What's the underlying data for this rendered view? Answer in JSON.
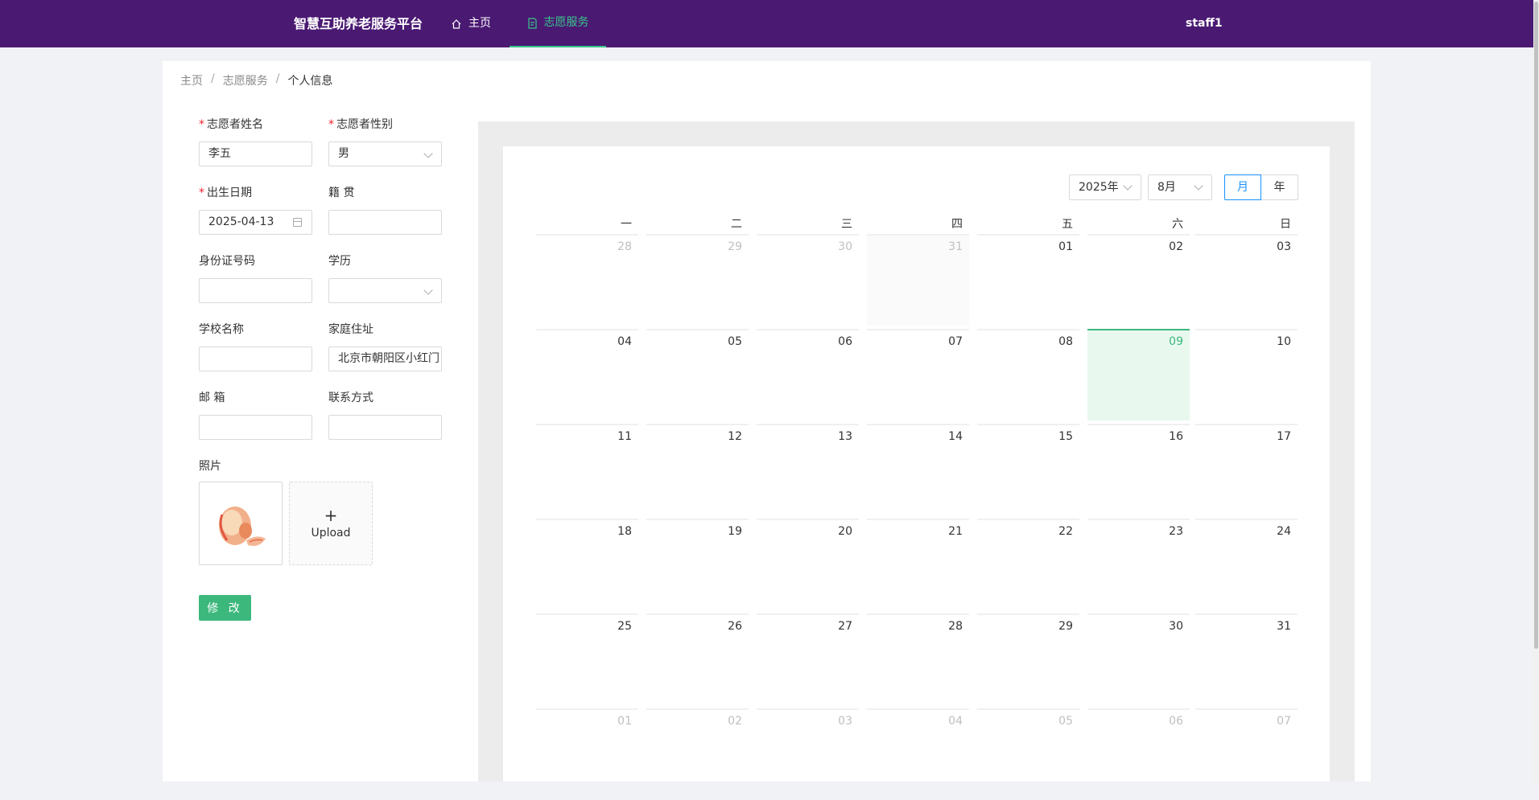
{
  "header": {
    "brand": "智慧互助养老服务平台",
    "nav": [
      {
        "label": "主页",
        "icon": "home-icon"
      },
      {
        "label": "志愿服务",
        "icon": "form-icon"
      }
    ],
    "user": "staff1",
    "colors": {
      "bar": "#4a1a73",
      "active": "#39c48a"
    }
  },
  "breadcrumb": [
    "主页",
    "/",
    "志愿服务",
    "/",
    "个人信息"
  ],
  "form": {
    "name": {
      "label": "志愿者姓名",
      "value": "李五",
      "required": true
    },
    "gender": {
      "label": "志愿者性别",
      "value": "男",
      "required": true
    },
    "birth": {
      "label": "出生日期",
      "value": "2025-04-13",
      "required": true
    },
    "origin": {
      "label": "籍 贯",
      "value": ""
    },
    "id_no": {
      "label": "身份证号码",
      "value": ""
    },
    "education": {
      "label": "学历",
      "value": ""
    },
    "school": {
      "label": "学校名称",
      "value": ""
    },
    "address": {
      "label": "家庭住址",
      "value": "北京市朝阳区小红门"
    },
    "email": {
      "label": "邮 箱",
      "value": ""
    },
    "contact": {
      "label": "联系方式",
      "value": ""
    },
    "photo": {
      "label": "照片",
      "upload_label": "Upload",
      "plus": "+"
    },
    "submit_label": "修 改"
  },
  "calendar": {
    "year_select": "2025年",
    "month_select": "8月",
    "modes": [
      "月",
      "年"
    ],
    "active_mode": "月",
    "weekdays": [
      "一",
      "二",
      "三",
      "四",
      "五",
      "六",
      "日"
    ],
    "weeks": [
      [
        "28",
        "29",
        "30",
        "31",
        "01",
        "02",
        "03"
      ],
      [
        "04",
        "05",
        "06",
        "07",
        "08",
        "09",
        "10"
      ],
      [
        "11",
        "12",
        "13",
        "14",
        "15",
        "16",
        "17"
      ],
      [
        "18",
        "19",
        "20",
        "21",
        "22",
        "23",
        "24"
      ],
      [
        "25",
        "26",
        "27",
        "28",
        "29",
        "30",
        "31"
      ],
      [
        "01",
        "02",
        "03",
        "04",
        "05",
        "06",
        "07"
      ]
    ],
    "today": "09",
    "accent": "#3cb87c"
  }
}
